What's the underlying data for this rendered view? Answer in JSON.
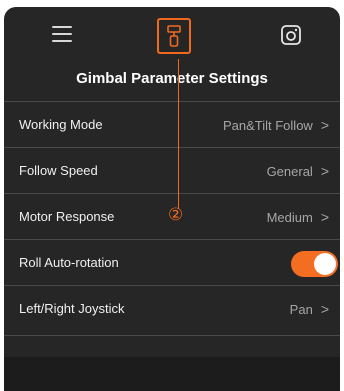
{
  "header": {
    "menu_icon": "hamburger-menu-icon",
    "gimbal_icon": "gimbal-icon",
    "camera_icon": "camera-icon"
  },
  "title": "Gimbal Parameter Settings",
  "settings": [
    {
      "label": "Working Mode",
      "value": "Pan&Tilt Follow"
    },
    {
      "label": "Follow Speed",
      "value": "General"
    },
    {
      "label": "Motor Response",
      "value": "Medium"
    },
    {
      "label": "Roll Auto-rotation",
      "toggle": true
    },
    {
      "label": "Left/Right Joystick",
      "value": "Pan"
    }
  ],
  "chevron": ">",
  "annotation": {
    "number": "②"
  },
  "colors": {
    "background": "#262626",
    "accent": "#f36d23",
    "divider": "#4a4a4a",
    "value_text": "#a6a6a6"
  }
}
